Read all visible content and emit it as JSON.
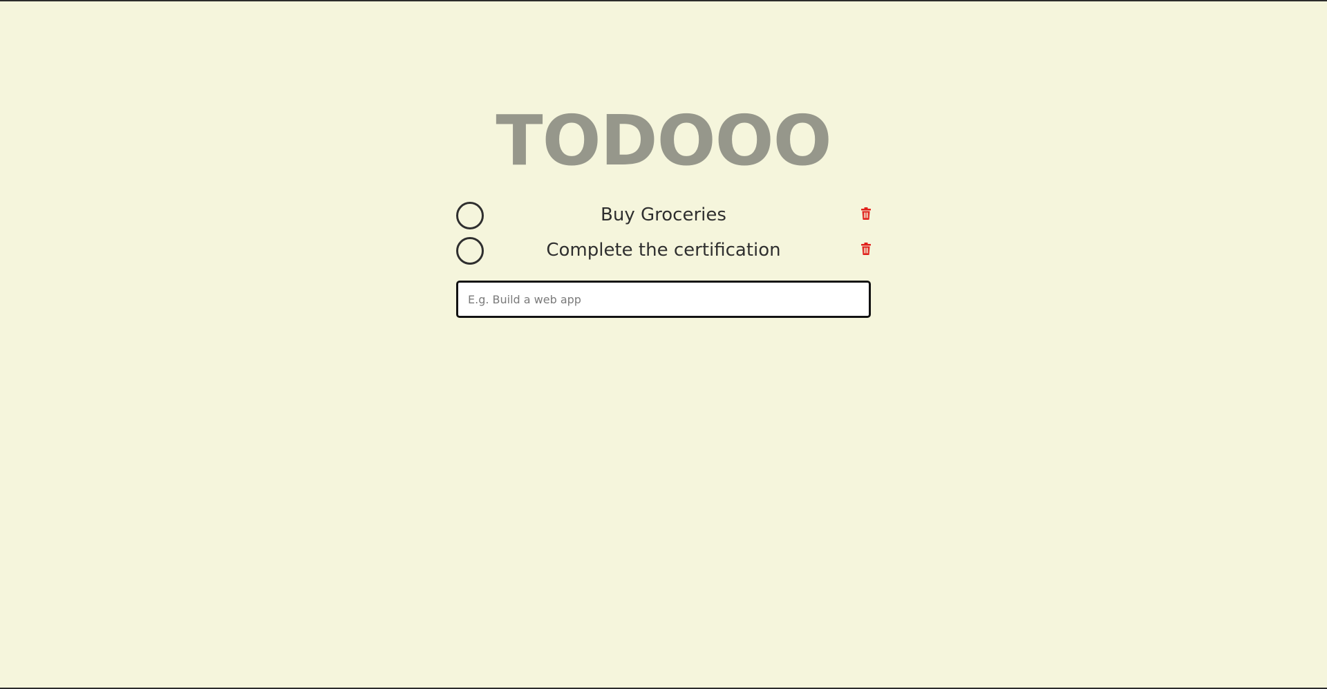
{
  "app": {
    "title": "TODOOO"
  },
  "todos": [
    {
      "text": "Buy Groceries",
      "completed": false
    },
    {
      "text": "Complete the certification",
      "completed": false
    }
  ],
  "new_todo": {
    "value": "",
    "placeholder": "E.g. Build a web app"
  },
  "icons": {
    "checkbox": "circle-outline-icon",
    "delete": "trash-icon"
  },
  "colors": {
    "background": "#f5f5dc",
    "title": "#96978b",
    "text": "#2f2f2f",
    "delete": "#e0201b"
  }
}
